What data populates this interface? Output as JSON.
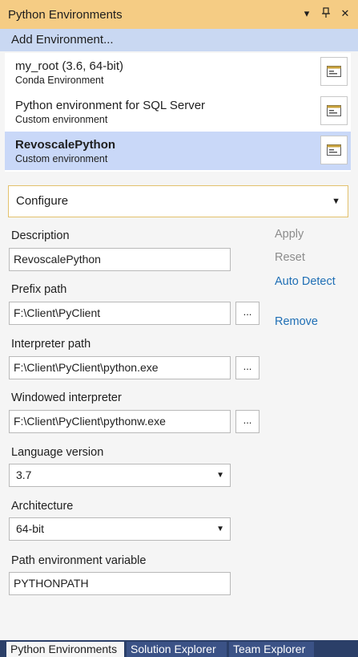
{
  "window": {
    "title": "Python Environments",
    "controls": [
      "dropdown-icon",
      "pin-icon",
      "close-icon"
    ]
  },
  "add_environment": "Add Environment...",
  "environments": [
    {
      "name": "my_root (3.6, 64-bit)",
      "type": "Conda Environment",
      "selected": false
    },
    {
      "name": "Python environment for SQL Server",
      "type": "Custom environment",
      "selected": false
    },
    {
      "name": "RevoscalePython",
      "type": "Custom environment",
      "selected": true
    }
  ],
  "view_select": {
    "value": "Configure"
  },
  "form": {
    "description": {
      "label": "Description",
      "value": "RevoscalePython"
    },
    "prefix_path": {
      "label": "Prefix path",
      "value": "F:\\Client\\PyClient"
    },
    "interpreter_path": {
      "label": "Interpreter path",
      "value": "F:\\Client\\PyClient\\python.exe"
    },
    "windowed_interpreter": {
      "label": "Windowed interpreter",
      "value": "F:\\Client\\PyClient\\pythonw.exe"
    },
    "language_version": {
      "label": "Language version",
      "value": "3.7"
    },
    "architecture": {
      "label": "Architecture",
      "value": "64-bit"
    },
    "path_env_var": {
      "label": "Path environment variable",
      "value": "PYTHONPATH"
    },
    "browse_label": "..."
  },
  "actions": {
    "apply": "Apply",
    "reset": "Reset",
    "auto_detect": "Auto Detect",
    "remove": "Remove"
  },
  "tabs": [
    {
      "label": "Python Environments",
      "active": true
    },
    {
      "label": "Solution Explorer",
      "active": false
    },
    {
      "label": "Team Explorer",
      "active": false
    }
  ],
  "colors": {
    "title_bar": "#f5cc84",
    "selection": "#c9d8f8",
    "link": "#1f6fb5",
    "tab_bar": "#2b3f68"
  }
}
